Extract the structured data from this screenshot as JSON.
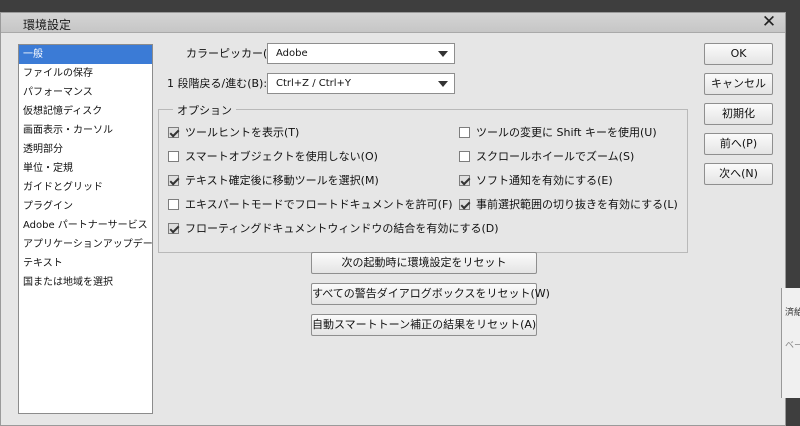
{
  "window": {
    "title": "環境設定",
    "close_icon": "close-icon"
  },
  "sidebar": {
    "items": [
      {
        "label": "一般",
        "selected": true
      },
      {
        "label": "ファイルの保存"
      },
      {
        "label": "パフォーマンス"
      },
      {
        "label": "仮想記憶ディスク"
      },
      {
        "label": "画面表示・カーソル"
      },
      {
        "label": "透明部分"
      },
      {
        "label": "単位・定規"
      },
      {
        "label": "ガイドとグリッド"
      },
      {
        "label": "プラグイン"
      },
      {
        "label": "Adobe パートナーサービス"
      },
      {
        "label": "アプリケーションアップデート"
      },
      {
        "label": "テキスト"
      },
      {
        "label": "国または地域を選択"
      }
    ]
  },
  "fields": {
    "color_picker": {
      "label": "カラーピッカー(C):",
      "value": "Adobe"
    },
    "step_back": {
      "label": "1 段階戻る/進む(B):",
      "value": "Ctrl+Z / Ctrl+Y"
    }
  },
  "options": {
    "legend": "オプション",
    "items": [
      {
        "label": "ツールヒントを表示(T)",
        "checked": true
      },
      {
        "label": "ツールの変更に Shift キーを使用(U)",
        "checked": false
      },
      {
        "label": "スマートオブジェクトを使用しない(O)",
        "checked": false
      },
      {
        "label": "スクロールホイールでズーム(S)",
        "checked": false
      },
      {
        "label": "テキスト確定後に移動ツールを選択(M)",
        "checked": true
      },
      {
        "label": "ソフト通知を有効にする(E)",
        "checked": true
      },
      {
        "label": "エキスパートモードでフロートドキュメントを許可(F)",
        "checked": false
      },
      {
        "label": "事前選択範囲の切り抜きを有効にする(L)",
        "checked": true
      },
      {
        "label": "フローティングドキュメントウィンドウの結合を有効にする(D)",
        "checked": true
      }
    ]
  },
  "reset_buttons": {
    "next_launch": "次の起動時に環境設定をリセット",
    "warnings": "すべての警告ダイアログボックスをリセット(W)",
    "auto_smart_tone": "自動スマートトーン補正の結果をリセット(A)"
  },
  "buttons": {
    "ok": "OK",
    "cancel": "キャンセル",
    "reset": "初期化",
    "prev": "前へ(P)",
    "next": "次へ(N)"
  },
  "background_window": {
    "text1": "済給",
    "text2": "ベー"
  }
}
